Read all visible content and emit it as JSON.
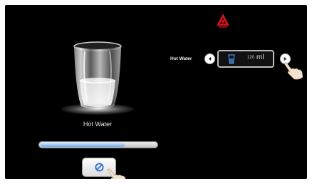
{
  "product": {
    "label": "Hot Water",
    "progress_fraction": 0.73
  },
  "selector": {
    "label": "Hot Water",
    "volume_value": "120",
    "volume_unit": "ml"
  },
  "icons": {
    "logo": "brand-logo-icon",
    "cup": "cup-icon",
    "left_arrow": "chevron-left-icon",
    "right_arrow": "chevron-right-icon",
    "stop": "cancel-icon",
    "hand": "pointing-hand-icon"
  },
  "colors": {
    "background": "#000000",
    "logo_red": "#c8141e",
    "accent_blue": "#2d6fd6",
    "progress_fill": "#6fa8e8"
  }
}
